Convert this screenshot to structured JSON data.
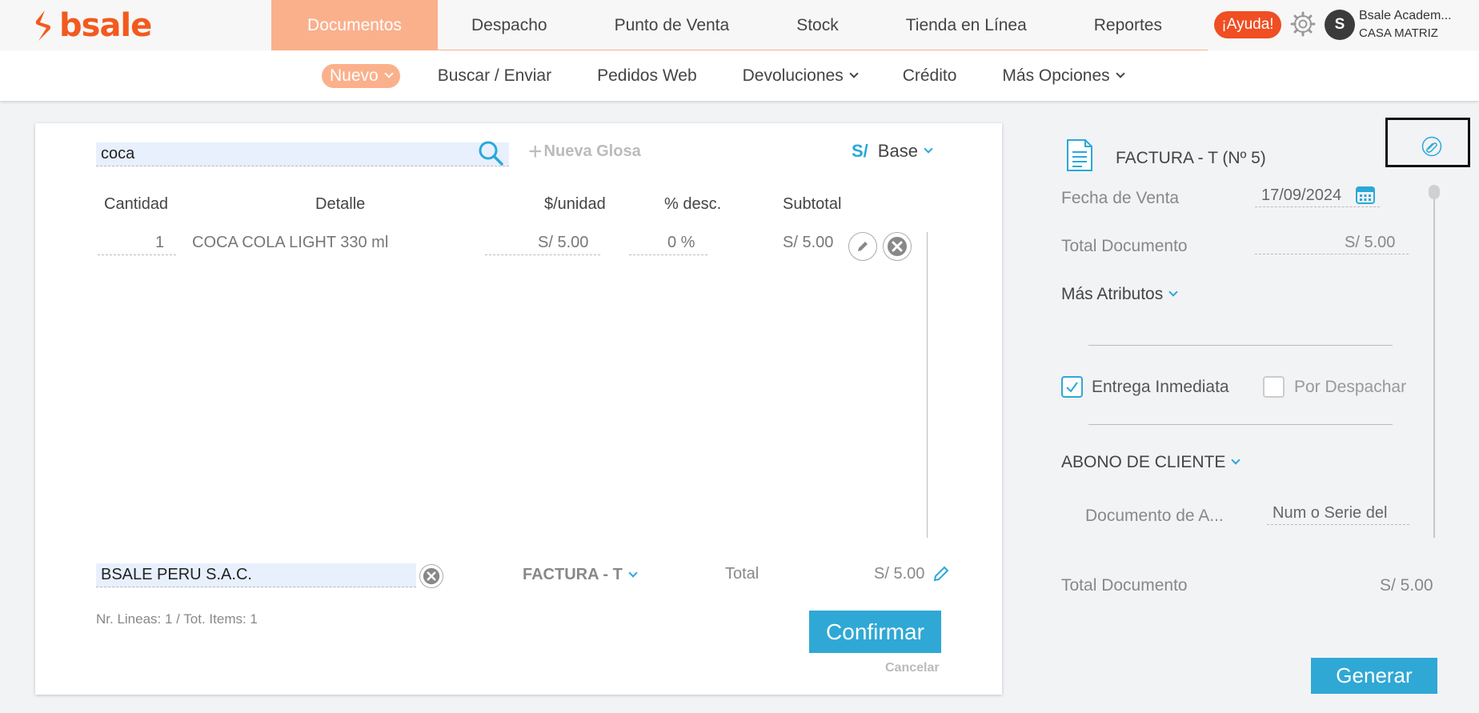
{
  "header": {
    "logo_text": "bsale",
    "brand_color": "#f25a1e",
    "nav": [
      "Documentos",
      "Despacho",
      "Punto de Venta",
      "Stock",
      "Tienda en Línea",
      "Reportes"
    ],
    "help_label": "¡Ayuda!",
    "avatar_initial": "S",
    "user_name": "Bsale Academ...",
    "branch": "CASA MATRIZ"
  },
  "subnav": {
    "nuevo": "Nuevo",
    "buscar": "Buscar / Enviar",
    "pedidos": "Pedidos Web",
    "devoluciones": "Devoluciones",
    "credito": "Crédito",
    "mas": "Más Opciones"
  },
  "doc": {
    "search_value": "coca",
    "nueva_glosa": "Nueva Glosa",
    "currency_symbol": "S/",
    "currency_name": "Base",
    "columns": {
      "cantidad": "Cantidad",
      "detalle": "Detalle",
      "unit": "$/unidad",
      "desc": "% desc.",
      "subtotal": "Subtotal"
    },
    "row": {
      "qty": "1",
      "detail": "COCA COLA LIGHT 330 ml",
      "unit_price": "S/ 5.00",
      "discount": "0 %",
      "subtotal": "S/ 5.00"
    },
    "client": "BSALE PERU S.A.C.",
    "doc_type": "FACTURA - T",
    "total_label": "Total",
    "total_value": "S/ 5.00",
    "lines_info": "Nr. Lineas: 1 / Tot. Items: 1",
    "confirm": "Confirmar",
    "cancel": "Cancelar"
  },
  "panel": {
    "title": "FACTURA - T (Nº 5)",
    "fecha_label": "Fecha de Venta",
    "fecha_value": "17/09/2024",
    "total_doc_label": "Total Documento",
    "total_doc_value": "S/ 5.00",
    "mas_atributos": "Más Atributos",
    "entrega": "Entrega Inmediata",
    "entrega_checked": true,
    "despachar": "Por Despachar",
    "despachar_checked": false,
    "abono": "ABONO DE CLIENTE",
    "doc_anterior_label": "Documento de A...",
    "doc_anterior_placeholder": "Num o Serie del",
    "footer_total_label": "Total Documento",
    "footer_total_value": "S/ 5.00",
    "generar": "Generar"
  }
}
